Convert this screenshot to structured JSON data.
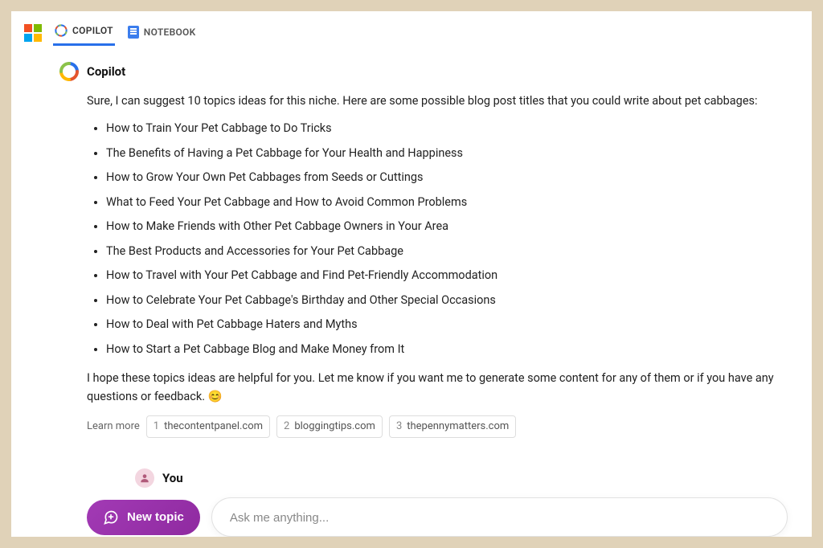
{
  "tabs": {
    "copilot": "COPILOT",
    "notebook": "NOTEBOOK"
  },
  "message": {
    "sender": "Copilot",
    "intro": "Sure, I can suggest 10 topics ideas for this niche. Here are some possible blog post titles that you could write about pet cabbages:",
    "items": [
      "How to Train Your Pet Cabbage to Do Tricks",
      "The Benefits of Having a Pet Cabbage for Your Health and Happiness",
      "How to Grow Your Own Pet Cabbages from Seeds or Cuttings",
      "What to Feed Your Pet Cabbage and How to Avoid Common Problems",
      "How to Make Friends with Other Pet Cabbage Owners in Your Area",
      "The Best Products and Accessories for Your Pet Cabbage",
      "How to Travel with Your Pet Cabbage and Find Pet-Friendly Accommodation",
      "How to Celebrate Your Pet Cabbage's Birthday and Other Special Occasions",
      "How to Deal with Pet Cabbage Haters and Myths",
      "How to Start a Pet Cabbage Blog and Make Money from It"
    ],
    "outro": "I hope these topics ideas are helpful for you. Let me know if you want me to generate some content for any of them or if you have any questions or feedback. 😊",
    "learn_more_label": "Learn more",
    "citations": [
      {
        "num": "1",
        "site": "thecontentpanel.com"
      },
      {
        "num": "2",
        "site": "bloggingtips.com"
      },
      {
        "num": "3",
        "site": "thepennymatters.com"
      }
    ]
  },
  "you_label": "You",
  "new_topic_label": "New topic",
  "ask_placeholder": "Ask me anything..."
}
